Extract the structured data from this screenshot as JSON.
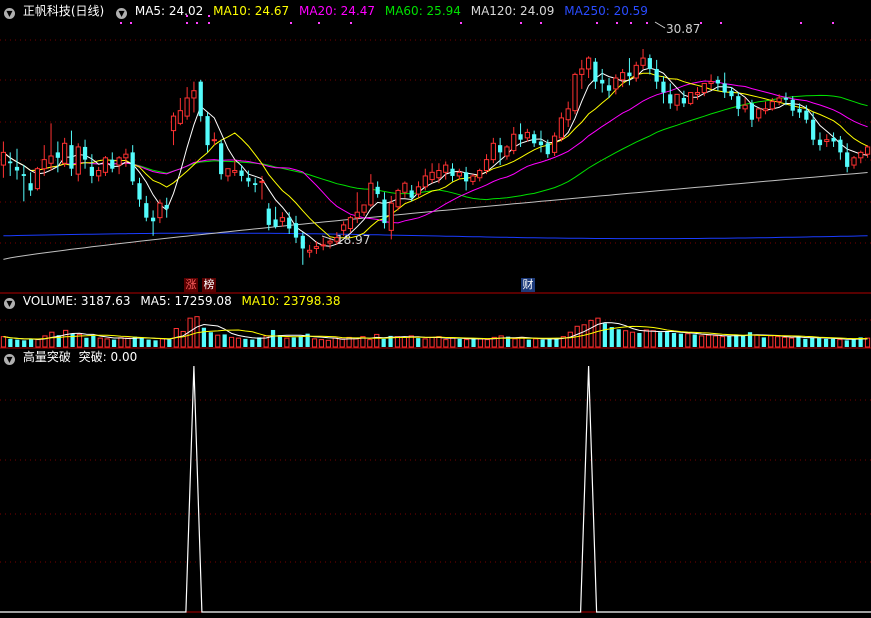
{
  "header": {
    "stock_title": "正帆科技(日线)",
    "ma5": "MA5: 24.02",
    "ma10": "MA10: 24.67",
    "ma20": "MA20: 24.47",
    "ma60": "MA60: 25.94",
    "ma120": "MA120: 24.09",
    "ma250": "MA250: 20.59"
  },
  "volume_header": {
    "title": "VOLUME: 3187.63",
    "ma5": "MA5: 17259.08",
    "ma10": "MA10: 23798.38"
  },
  "indicator_header": {
    "title": "高量突破",
    "value": "突破: 0.00"
  },
  "annotations": {
    "high": "30.87",
    "low": "18.97",
    "tag_zhang": "涨",
    "tag_bang": "榜",
    "tag_cai": "财"
  },
  "colors": {
    "up": "#ff3232",
    "down": "#54fcfc",
    "ma5": "#ffffff",
    "ma10": "#ffff00",
    "ma20": "#ff00ff",
    "ma60": "#00e000",
    "ma120": "#c0c0c0",
    "ma250": "#1a3cff",
    "grid": "#7a0000"
  },
  "chart_data": [
    {
      "type": "candlestick",
      "title": "正帆科技(日线)",
      "ylim": [
        17.5,
        32.5
      ],
      "high_label": 30.87,
      "low_label": 18.97,
      "candles": [
        [
          24.5,
          25.8,
          25.2,
          23.8
        ],
        [
          24.7,
          25.2,
          24.6,
          23.9
        ],
        [
          24.4,
          25.4,
          24.2,
          23.7
        ],
        [
          24.0,
          24.5,
          23.9,
          22.5
        ],
        [
          23.5,
          24.1,
          23.1,
          22.8
        ],
        [
          23.2,
          24.4,
          24.3,
          23.1
        ],
        [
          24.3,
          25.6,
          24.8,
          23.9
        ],
        [
          24.6,
          26.8,
          25.0,
          24.2
        ],
        [
          25.2,
          25.8,
          24.9,
          24.1
        ],
        [
          24.6,
          26.0,
          25.7,
          24.4
        ],
        [
          25.6,
          26.4,
          24.3,
          23.9
        ],
        [
          24.0,
          25.7,
          25.5,
          23.6
        ],
        [
          25.5,
          25.9,
          24.8,
          24.3
        ],
        [
          24.4,
          25.1,
          23.9,
          23.5
        ],
        [
          23.9,
          24.4,
          24.2,
          23.6
        ],
        [
          24.1,
          25.0,
          24.9,
          23.9
        ],
        [
          24.8,
          25.2,
          24.3,
          24.1
        ],
        [
          24.5,
          25.0,
          24.9,
          24.0
        ],
        [
          24.9,
          25.4,
          25.1,
          24.4
        ],
        [
          25.2,
          25.6,
          23.6,
          23.4
        ],
        [
          23.5,
          23.8,
          22.6,
          22.2
        ],
        [
          22.4,
          22.8,
          21.6,
          21.4
        ],
        [
          21.6,
          22.0,
          21.4,
          20.6
        ],
        [
          21.6,
          22.6,
          22.4,
          21.3
        ],
        [
          22.3,
          22.7,
          22.1,
          21.6
        ],
        [
          26.4,
          27.4,
          27.2,
          25.6
        ],
        [
          26.8,
          28.2,
          27.5,
          26.7
        ],
        [
          27.2,
          28.8,
          28.2,
          27.0
        ],
        [
          28.2,
          29.1,
          28.6,
          27.4
        ],
        [
          29.1,
          29.2,
          27.2,
          26.9
        ],
        [
          27.2,
          27.4,
          25.6,
          25.2
        ],
        [
          25.9,
          26.3,
          25.9,
          25.6
        ],
        [
          25.7,
          25.9,
          24.0,
          23.7
        ],
        [
          23.9,
          24.2,
          24.3,
          23.6
        ],
        [
          24.1,
          24.8,
          24.2,
          23.9
        ],
        [
          24.2,
          24.5,
          23.9,
          23.6
        ],
        [
          23.8,
          24.2,
          23.6,
          23.3
        ],
        [
          23.5,
          23.8,
          23.4,
          23.0
        ],
        [
          23.6,
          23.9,
          23.6,
          22.6
        ],
        [
          22.1,
          22.4,
          21.2,
          20.9
        ],
        [
          21.5,
          22.2,
          21.1,
          21.0
        ],
        [
          21.4,
          21.9,
          21.6,
          21.1
        ],
        [
          21.6,
          21.9,
          21.0,
          20.7
        ],
        [
          21.3,
          21.7,
          20.5,
          20.2
        ],
        [
          20.6,
          20.8,
          19.9,
          19.0
        ],
        [
          19.7,
          20.1,
          19.8,
          19.4
        ],
        [
          19.9,
          20.3,
          20.0,
          19.6
        ],
        [
          20.1,
          20.5,
          20.1,
          19.8
        ],
        [
          20.2,
          20.5,
          20.3,
          19.9
        ],
        [
          20.3,
          20.8,
          20.5,
          20.1
        ],
        [
          20.9,
          21.4,
          21.2,
          20.6
        ],
        [
          21.0,
          21.7,
          21.6,
          20.8
        ],
        [
          21.6,
          23.0,
          21.9,
          21.3
        ],
        [
          21.9,
          22.3,
          22.3,
          21.7
        ],
        [
          22.3,
          24.0,
          23.5,
          22.2
        ],
        [
          23.3,
          23.6,
          22.9,
          22.7
        ],
        [
          22.6,
          23.0,
          21.3,
          21.0
        ],
        [
          20.9,
          22.8,
          22.4,
          20.4
        ],
        [
          22.2,
          23.2,
          23.1,
          22.0
        ],
        [
          23.0,
          23.6,
          23.5,
          22.7
        ],
        [
          23.1,
          23.4,
          22.7,
          22.5
        ],
        [
          22.9,
          23.6,
          23.3,
          22.7
        ],
        [
          23.3,
          24.3,
          23.9,
          23.1
        ],
        [
          23.7,
          24.6,
          24.1,
          23.5
        ],
        [
          23.8,
          24.6,
          24.2,
          23.5
        ],
        [
          24.1,
          24.7,
          24.5,
          23.7
        ],
        [
          24.3,
          24.6,
          23.9,
          23.6
        ],
        [
          23.9,
          24.3,
          24.1,
          23.7
        ],
        [
          24.1,
          24.4,
          23.6,
          23.1
        ],
        [
          23.6,
          24.0,
          23.9,
          23.4
        ],
        [
          23.8,
          24.3,
          24.2,
          23.6
        ],
        [
          24.2,
          25.1,
          24.8,
          24.0
        ],
        [
          24.8,
          26.0,
          25.7,
          24.6
        ],
        [
          25.6,
          26.0,
          25.2,
          24.5
        ],
        [
          25.0,
          25.6,
          25.5,
          24.8
        ],
        [
          25.3,
          26.6,
          26.2,
          25.1
        ],
        [
          26.2,
          26.8,
          25.9,
          25.5
        ],
        [
          26.0,
          26.5,
          26.3,
          25.8
        ],
        [
          26.2,
          26.4,
          25.7,
          25.5
        ],
        [
          25.8,
          26.4,
          25.6,
          25.2
        ],
        [
          25.7,
          25.9,
          25.1,
          24.9
        ],
        [
          25.2,
          26.3,
          26.1,
          25.0
        ],
        [
          26.0,
          27.4,
          27.1,
          25.8
        ],
        [
          27.0,
          28.0,
          27.6,
          26.6
        ],
        [
          27.5,
          29.6,
          29.5,
          27.3
        ],
        [
          29.5,
          30.3,
          29.8,
          28.7
        ],
        [
          29.8,
          30.5,
          30.4,
          29.3
        ],
        [
          30.2,
          30.4,
          29.1,
          28.7
        ],
        [
          29.2,
          29.8,
          29.0,
          28.5
        ],
        [
          28.9,
          29.3,
          28.6,
          28.2
        ],
        [
          28.7,
          29.5,
          29.3,
          28.4
        ],
        [
          29.2,
          29.8,
          29.6,
          28.8
        ],
        [
          29.6,
          30.4,
          29.4,
          28.9
        ],
        [
          29.3,
          30.2,
          30.0,
          29.1
        ],
        [
          30.0,
          30.9,
          30.4,
          29.8
        ],
        [
          30.4,
          30.6,
          29.8,
          29.5
        ],
        [
          29.8,
          30.3,
          29.1,
          28.7
        ],
        [
          29.1,
          29.4,
          28.5,
          27.9
        ],
        [
          28.4,
          29.0,
          27.9,
          27.6
        ],
        [
          27.8,
          28.4,
          28.4,
          27.5
        ],
        [
          28.2,
          28.6,
          27.9,
          27.7
        ],
        [
          27.9,
          28.5,
          28.5,
          27.8
        ],
        [
          28.4,
          28.8,
          28.5,
          28.1
        ],
        [
          28.5,
          28.9,
          29.0,
          28.3
        ],
        [
          29.0,
          29.5,
          29.1,
          28.7
        ],
        [
          29.2,
          29.4,
          29.0,
          28.6
        ],
        [
          29.0,
          29.6,
          28.5,
          28.2
        ],
        [
          28.6,
          28.8,
          28.3,
          28.1
        ],
        [
          28.3,
          28.5,
          27.6,
          27.2
        ],
        [
          27.6,
          28.2,
          27.8,
          27.4
        ],
        [
          27.9,
          28.1,
          27.0,
          26.6
        ],
        [
          27.1,
          27.6,
          27.6,
          26.9
        ],
        [
          27.5,
          28.0,
          27.6,
          27.3
        ],
        [
          27.6,
          28.2,
          28.0,
          27.5
        ],
        [
          28.0,
          28.4,
          28.2,
          27.8
        ],
        [
          28.2,
          28.5,
          28.1,
          27.8
        ],
        [
          28.1,
          28.3,
          27.5,
          27.2
        ],
        [
          27.6,
          27.9,
          27.4,
          27.1
        ],
        [
          27.5,
          27.8,
          27.0,
          26.8
        ],
        [
          27.0,
          27.4,
          25.9,
          25.6
        ],
        [
          25.9,
          26.3,
          25.6,
          25.3
        ],
        [
          25.8,
          26.2,
          25.9,
          25.5
        ],
        [
          26.0,
          26.3,
          25.8,
          25.5
        ],
        [
          25.9,
          26.1,
          25.2,
          24.8
        ],
        [
          25.2,
          25.7,
          24.4,
          24.1
        ],
        [
          24.5,
          25.0,
          24.9,
          24.3
        ],
        [
          24.9,
          25.3,
          25.2,
          24.6
        ],
        [
          25.1,
          25.6,
          25.5,
          24.9
        ]
      ],
      "ma_lines": {
        "ma250_range": [
          20.6,
          20.59
        ],
        "ma120_range": [
          19.3,
          24.09
        ]
      }
    },
    {
      "type": "bar",
      "title": "VOLUME: 3187.63",
      "ylim": [
        0,
        100
      ],
      "values": [
        28,
        22,
        20,
        18,
        22,
        20,
        30,
        40,
        32,
        45,
        36,
        34,
        25,
        30,
        24,
        22,
        20,
        25,
        24,
        28,
        26,
        20,
        18,
        22,
        20,
        50,
        42,
        78,
        82,
        52,
        40,
        32,
        34,
        26,
        24,
        22,
        20,
        26,
        30,
        46,
        32,
        24,
        26,
        30,
        36,
        22,
        20,
        18,
        24,
        22,
        26,
        22,
        28,
        20,
        34,
        22,
        30,
        28,
        26,
        30,
        24,
        22,
        26,
        28,
        20,
        24,
        22,
        20,
        24,
        22,
        20,
        26,
        30,
        28,
        22,
        26,
        20,
        22,
        20,
        22,
        24,
        28,
        40,
        56,
        60,
        72,
        78,
        64,
        54,
        48,
        44,
        40,
        38,
        46,
        44,
        40,
        42,
        38,
        36,
        36,
        34,
        30,
        32,
        30,
        28,
        30,
        34,
        30,
        40,
        32,
        26,
        30,
        28,
        26,
        24,
        28,
        22,
        26,
        24,
        22,
        22,
        20,
        18,
        22,
        26,
        24
      ]
    },
    {
      "type": "line",
      "title": "高量突破",
      "ylim": [
        0,
        1
      ],
      "signal_indices": [
        28,
        86
      ],
      "value_label": "突破: 0.00"
    }
  ]
}
